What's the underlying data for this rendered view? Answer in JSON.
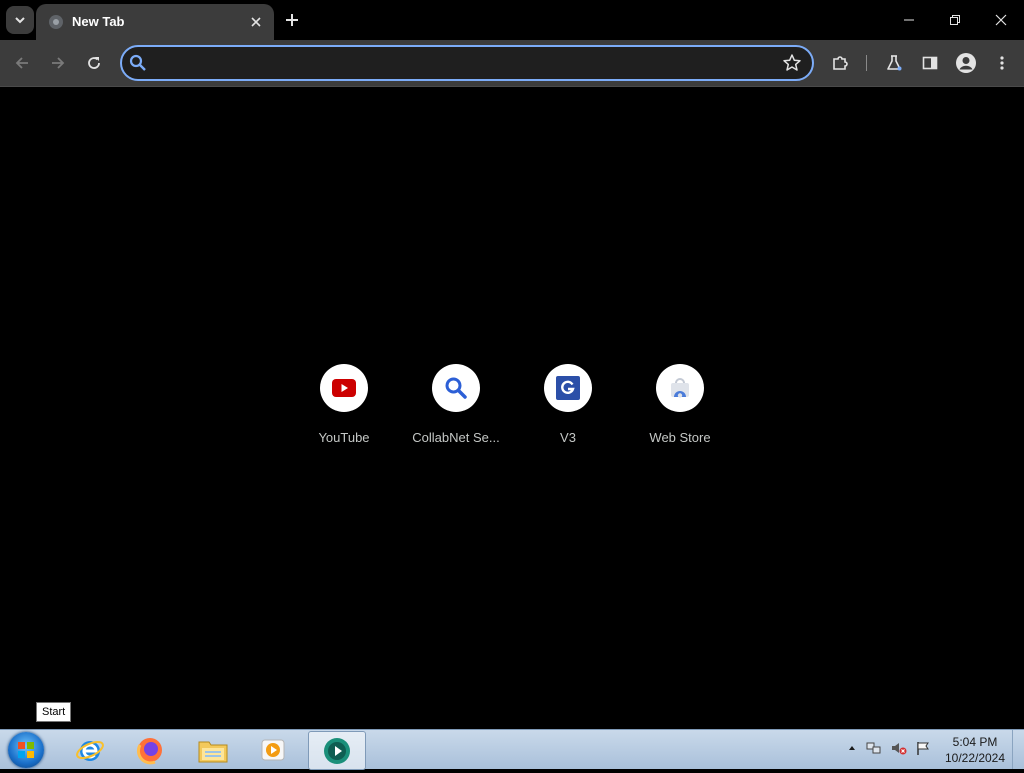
{
  "browser": {
    "tab": {
      "title": "New Tab",
      "favicon": "globe-icon"
    },
    "omnibox": {
      "value": "",
      "placeholder": ""
    },
    "accent": "#7cacf8"
  },
  "shortcuts": [
    {
      "label": "YouTube",
      "icon": "youtube-icon"
    },
    {
      "label": "CollabNet Se...",
      "icon": "search-icon"
    },
    {
      "label": "V3",
      "icon": "google-g-icon"
    },
    {
      "label": "Web Store",
      "icon": "web-store-icon"
    }
  ],
  "tooltip": {
    "text": "Start"
  },
  "taskbar": {
    "apps": [
      "internet-explorer-icon",
      "firefox-icon",
      "file-explorer-icon",
      "media-player-icon",
      "chrome-icon"
    ],
    "clock": {
      "time": "5:04 PM",
      "date": "10/22/2024"
    }
  }
}
